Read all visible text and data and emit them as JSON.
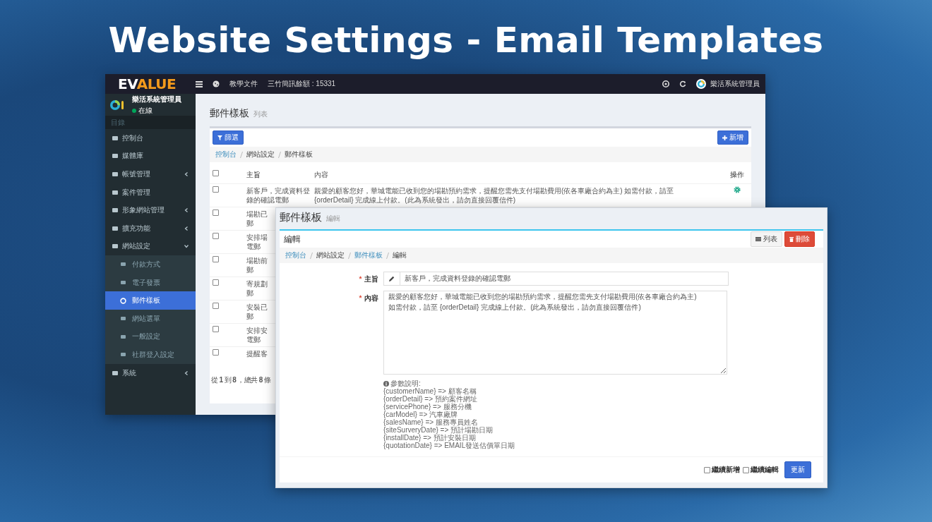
{
  "title": "Website Settings - Email Templates",
  "topbar": {
    "logo": "EVALUE",
    "links": [
      "教學文件",
      "三竹簡訊餘額 : 15331"
    ],
    "user": "樂活系統管理員"
  },
  "sidebar": {
    "user": {
      "name": "樂活系統管理員",
      "status": "在線"
    },
    "header": "目錄",
    "items": [
      {
        "label": "控制台",
        "selected": false
      },
      {
        "label": "媒體庫",
        "selected": false
      },
      {
        "label": "帳號管理",
        "selected": false,
        "expanded": false
      },
      {
        "label": "案件管理",
        "selected": false
      },
      {
        "label": "形象網站管理",
        "selected": false,
        "expanded": false
      },
      {
        "label": "擴充功能",
        "selected": false,
        "expanded": false
      },
      {
        "label": "網站設定",
        "selected": false,
        "expanded": true,
        "children": [
          {
            "label": "付款方式",
            "selected": false
          },
          {
            "label": "電子發票",
            "selected": false
          },
          {
            "label": "郵件樣板",
            "selected": true
          },
          {
            "label": "網站選單",
            "selected": false
          },
          {
            "label": "一般設定",
            "selected": false
          },
          {
            "label": "社群登入設定",
            "selected": false
          }
        ]
      },
      {
        "label": "系統",
        "selected": false,
        "expanded": false
      }
    ]
  },
  "list_page": {
    "title": "郵件樣板",
    "subtitle": "列表",
    "filter_button": "篩選",
    "add_button": "新增",
    "breadcrumb": [
      {
        "label": "控制台",
        "link": true
      },
      {
        "label": "網站設定",
        "link": false
      },
      {
        "label": "郵件樣板",
        "link": false
      }
    ],
    "columns": [
      "主旨",
      "內容",
      "操作"
    ],
    "select_all": {
      "checked": false
    },
    "rows": [
      {
        "checked": false,
        "subject": [
          "新客戶，完成資料登",
          "錄的確認電郵"
        ],
        "content": "親愛的顧客您好，華城電能已收到您的場勘預約需求，提醒您需先支付場勘費用(依各車廠合約為主) 如需付款，請至 {orderDetail} 完成線上付款。(此為系統發出，請勿直接回覆信件)"
      },
      {
        "checked": false,
        "subject": [
          "場勘已",
          "郵"
        ]
      },
      {
        "checked": false,
        "subject": [
          "安排場",
          "電郵"
        ]
      },
      {
        "checked": false,
        "subject": [
          "場勘前",
          "郵"
        ]
      },
      {
        "checked": false,
        "subject": [
          "寄規劃",
          "郵"
        ]
      },
      {
        "checked": false,
        "subject": [
          "安裝已",
          "郵"
        ]
      },
      {
        "checked": false,
        "subject": [
          "安排安",
          "電郵"
        ]
      },
      {
        "checked": false,
        "subject": [
          "提醒客"
        ]
      }
    ],
    "footer": "從 **1** 到 **8** ，總共 **8** 條"
  },
  "edit_page": {
    "title": "郵件樣板",
    "subtitle": "編輯",
    "box_title": "編輯",
    "list_button": "列表",
    "delete_button": "刪除",
    "breadcrumb": [
      {
        "label": "控制台",
        "link": true
      },
      {
        "label": "網站設定",
        "link": false
      },
      {
        "label": "郵件樣板",
        "link": true
      },
      {
        "label": "編輯",
        "link": false
      }
    ],
    "fields": [
      {
        "label": "主旨",
        "required": true,
        "kind": "input",
        "value": "新客戶，完成資料登錄的確認電郵"
      },
      {
        "label": "內容",
        "required": true,
        "kind": "textarea",
        "value": "親愛的顧客您好，華城電能已收到您的場勘預約需求，提醒您需先支付場勘費用(依各車廠合約為主)\n如需付款，請至 {orderDetail} 完成線上付款。(此為系統發出，請勿直接回覆信件)"
      }
    ],
    "help_title": "參數說明:",
    "help_lines": [
      "{customerName} => 顧客名稱",
      "{orderDetail} => 預約案件網址",
      "{servicePhone} => 服務分機",
      "{carModel} => 汽車廠牌",
      "{salesName} => 服務專員姓名",
      "{siteSurveryDate} => 預計場勘日期",
      "{installDate} => 預計安裝日期",
      "{quotationDate} => EMAIL發送估價單日期"
    ],
    "options": [
      {
        "label": "繼續新增",
        "checked": false
      },
      {
        "label": "繼續編輯",
        "checked": false
      }
    ],
    "submit_button": "更新"
  }
}
